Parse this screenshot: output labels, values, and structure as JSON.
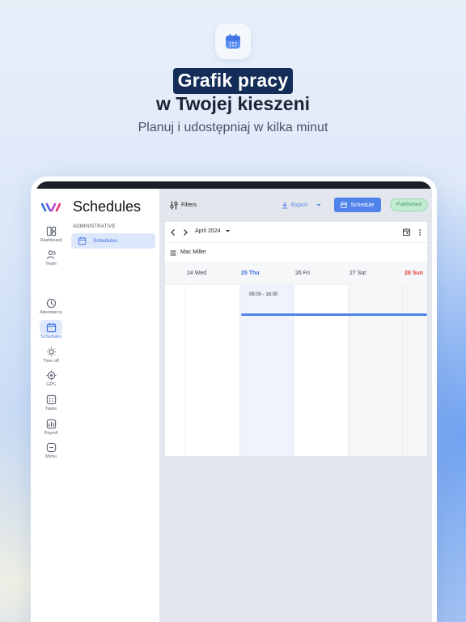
{
  "hero": {
    "title_highlight": "Grafik pracy",
    "title_line2": "w Twojej kieszeni",
    "subtitle": "Planuj i udostępniaj w kilka minut",
    "icon": "calendar-icon"
  },
  "rail": {
    "logo": "brand-logo",
    "items": [
      {
        "label": "Dashboard",
        "icon": "dashboard-icon"
      },
      {
        "label": "Team",
        "icon": "team-icon"
      },
      {
        "label": "Attendance",
        "icon": "clock-icon"
      },
      {
        "label": "Schedules",
        "icon": "calendar-icon",
        "active": true
      },
      {
        "label": "Time off",
        "icon": "sun-icon"
      },
      {
        "label": "GPS",
        "icon": "gps-icon"
      },
      {
        "label": "Tasks",
        "icon": "tasks-icon"
      },
      {
        "label": "Payroll",
        "icon": "payroll-icon"
      },
      {
        "label": "Menu",
        "icon": "menu-icon"
      }
    ]
  },
  "panel": {
    "title": "Schedules",
    "section": "ADMINISTRATIVE",
    "item": "Schedules"
  },
  "toolbar": {
    "filters": "Filters",
    "export": "Export",
    "schedule": "Schedule",
    "status": "Published"
  },
  "calendar": {
    "month": "April 2024",
    "employee": "Mac Miller",
    "days": [
      "24 Wed",
      "25 Thu",
      "26 Fri",
      "27 Sat",
      "28 Sun"
    ],
    "today_index": 1,
    "shift": {
      "time": "08:00 - 16:00"
    }
  },
  "colors": {
    "accent": "#4f83ea",
    "hero_highlight_bg": "#132c58",
    "published_bg": "#c2ecd0",
    "sunday": "#e23b3b"
  }
}
